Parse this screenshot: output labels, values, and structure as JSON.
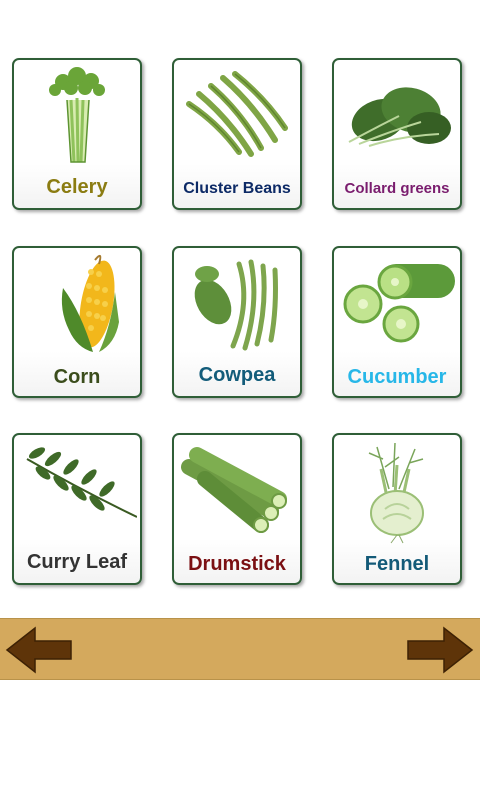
{
  "vegetables": [
    {
      "label": "Celery",
      "color": "#8b7c12",
      "icon": "celery-icon"
    },
    {
      "label": "Cluster Beans",
      "color": "#0d2a66",
      "icon": "cluster-beans-icon"
    },
    {
      "label": "Collard greens",
      "color": "#7a1d6e",
      "icon": "collard-greens-icon"
    },
    {
      "label": "Corn",
      "color": "#3b4d1c",
      "icon": "corn-icon"
    },
    {
      "label": "Cowpea",
      "color": "#135c7a",
      "icon": "cowpea-icon"
    },
    {
      "label": "Cucumber",
      "color": "#27b7e8",
      "icon": "cucumber-icon"
    },
    {
      "label": "Curry Leaf",
      "color": "#333333",
      "icon": "curry-leaf-icon"
    },
    {
      "label": "Drumstick",
      "color": "#7b1013",
      "icon": "drumstick-icon"
    },
    {
      "label": "Fennel",
      "color": "#135a78",
      "icon": "fennel-icon"
    }
  ],
  "navigation": {
    "bar_color": "#d4a95d",
    "arrow_color": "#5e3409",
    "back_icon": "left-arrow-icon",
    "next_icon": "right-arrow-icon"
  }
}
